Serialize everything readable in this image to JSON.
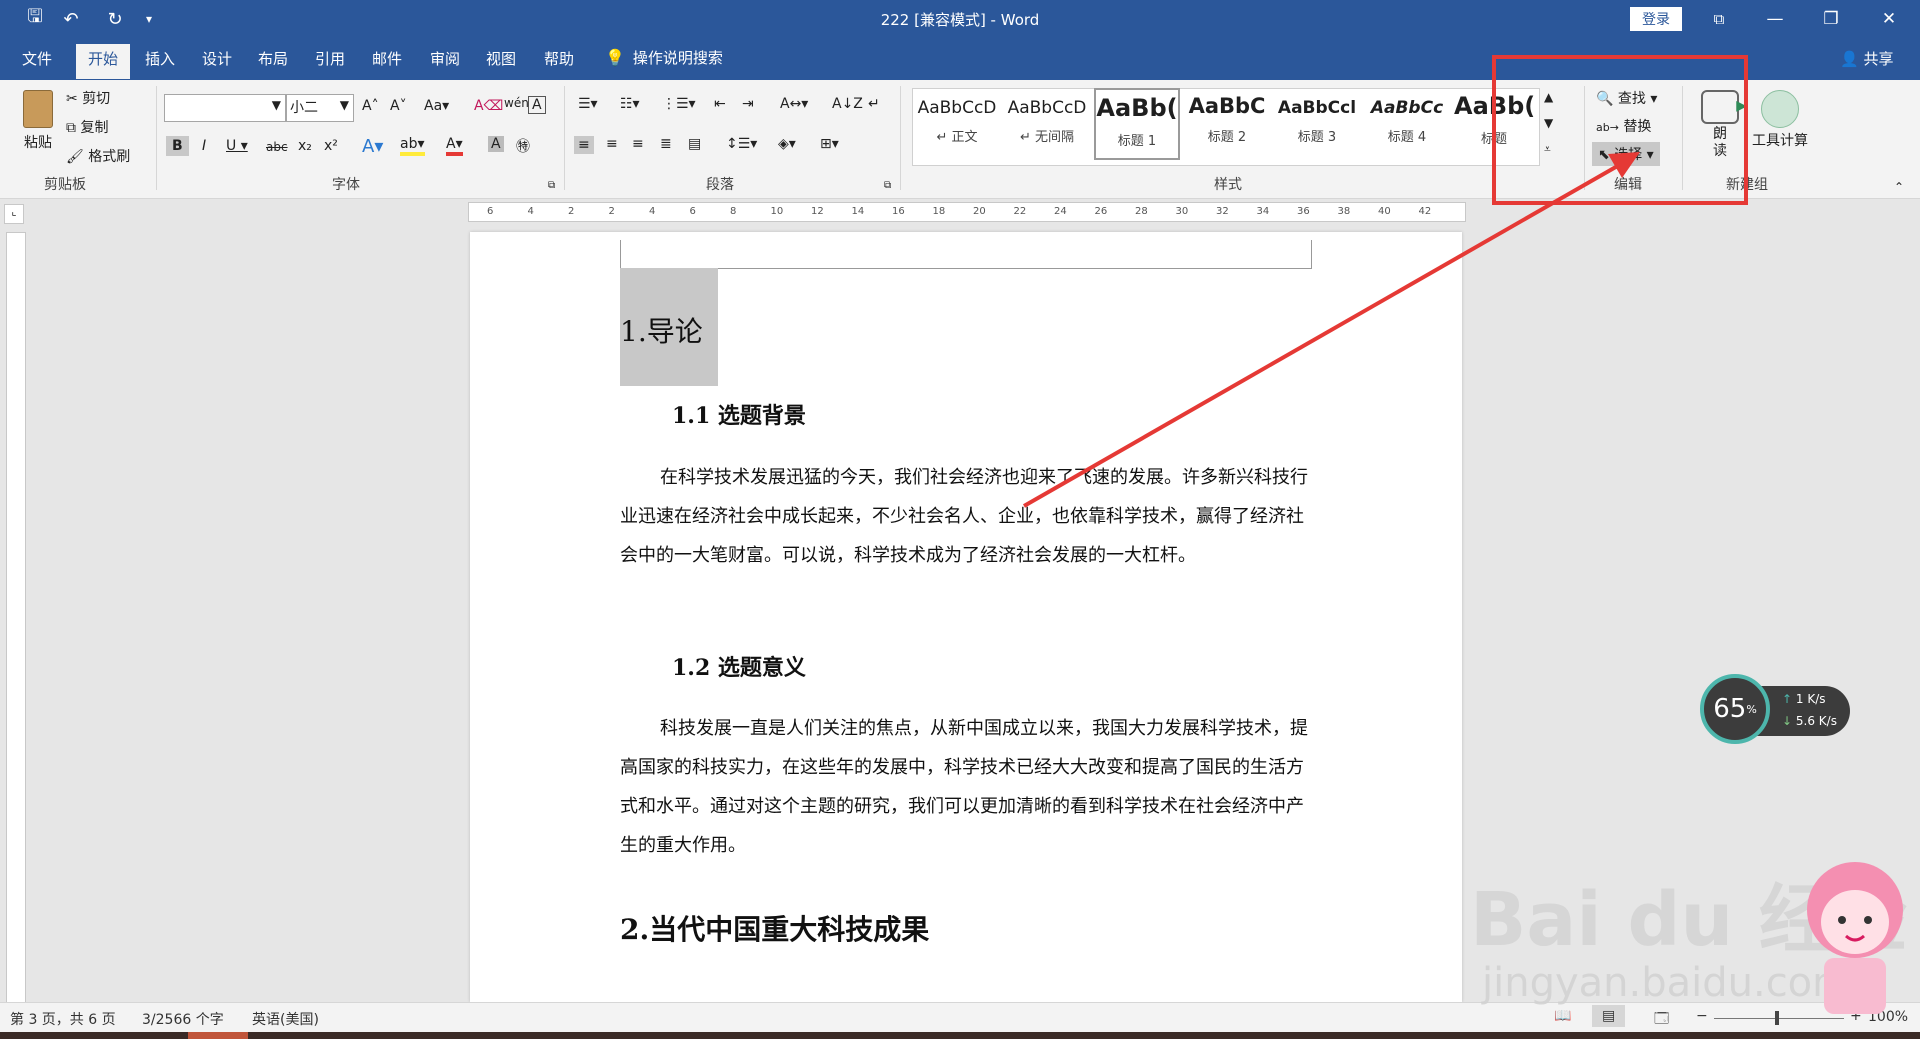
{
  "window": {
    "title": "222 [兼容模式] - Word",
    "login_label": "登录",
    "controls": {
      "restore_ribbon": "⧉",
      "minimize": "—",
      "maximize": "❐",
      "close": "✕"
    }
  },
  "quick_access": {
    "save": "🖫",
    "undo": "↶",
    "redo": "↻",
    "customize": "▾"
  },
  "menu": {
    "tabs": [
      "文件",
      "开始",
      "插入",
      "设计",
      "布局",
      "引用",
      "邮件",
      "审阅",
      "视图",
      "帮助"
    ],
    "active_tab": "开始",
    "search_hint": "操作说明搜索",
    "share_label": "共享"
  },
  "ribbon": {
    "clipboard": {
      "paste_label": "粘贴",
      "cut_label": "剪切",
      "copy_label": "复制",
      "format_painter_label": "格式刷",
      "group_label": "剪贴板"
    },
    "font": {
      "font_name": "",
      "font_size": "小二",
      "group_label": "字体"
    },
    "paragraph": {
      "group_label": "段落"
    },
    "styles": {
      "group_label": "样式",
      "items": [
        {
          "sample": "AaBbCcD",
          "name": "↵ 正文"
        },
        {
          "sample": "AaBbCcD",
          "name": "↵ 无间隔"
        },
        {
          "sample": "AaBb(",
          "name": "标题 1"
        },
        {
          "sample": "AaBbC",
          "name": "标题 2"
        },
        {
          "sample": "AaBbCcl",
          "name": "标题 3"
        },
        {
          "sample": "AaBbCc",
          "name": "标题 4"
        },
        {
          "sample": "AaBb(",
          "name": "标题"
        }
      ]
    },
    "editing": {
      "find_label": "查找",
      "replace_label": "替换",
      "select_label": "选择",
      "group_label": "编辑"
    },
    "new_group": {
      "read_aloud_label": "朗\n读",
      "tool_calc_label": "工具计算",
      "group_label": "新建组"
    }
  },
  "ruler": {
    "ticks": [
      "6",
      "4",
      "2",
      "2",
      "4",
      "6",
      "8",
      "10",
      "12",
      "14",
      "16",
      "18",
      "20",
      "22",
      "24",
      "26",
      "28",
      "30",
      "32",
      "34",
      "36",
      "38",
      "40",
      "42"
    ]
  },
  "document": {
    "h1_1": "1.导论",
    "h2_1": "1.1 选题背景",
    "p1": "在科学技术发展迅猛的今天，我们社会经济也迎来了飞速的发展。许多新兴科技行业迅速在经济社会中成长起来，不少社会名人、企业，也依靠科学技术，赢得了经济社会中的一大笔财富。可以说，科学技术成为了经济社会发展的一大杠杆。",
    "h2_2": "1.2 选题意义",
    "p2": "科技发展一直是人们关注的焦点，从新中国成立以来，我国大力发展科学技术，提高国家的科技实力，在这些年的发展中，科学技术已经大大改变和提高了国民的生活方式和水平。通过对这个主题的研究，我们可以更加清晰的看到科学技术在社会经济中产生的重大作用。",
    "h1_2": "2.当代中国重大科技成果"
  },
  "status": {
    "page": "第 3 页，共 6 页",
    "words": "3/2566 个字",
    "language": "英语(美国)",
    "zoom": "100%",
    "zoom_minus": "−",
    "zoom_plus": "+"
  },
  "net_widget": {
    "percent": "65",
    "percent_unit": "%",
    "up": "1 K/s",
    "down": "5.6 K/s"
  },
  "watermark": {
    "brand": "Bai du 经验",
    "url": "jingyan.baidu.com"
  },
  "colors": {
    "accent": "#2b579a",
    "annotation_red": "#e53935"
  }
}
